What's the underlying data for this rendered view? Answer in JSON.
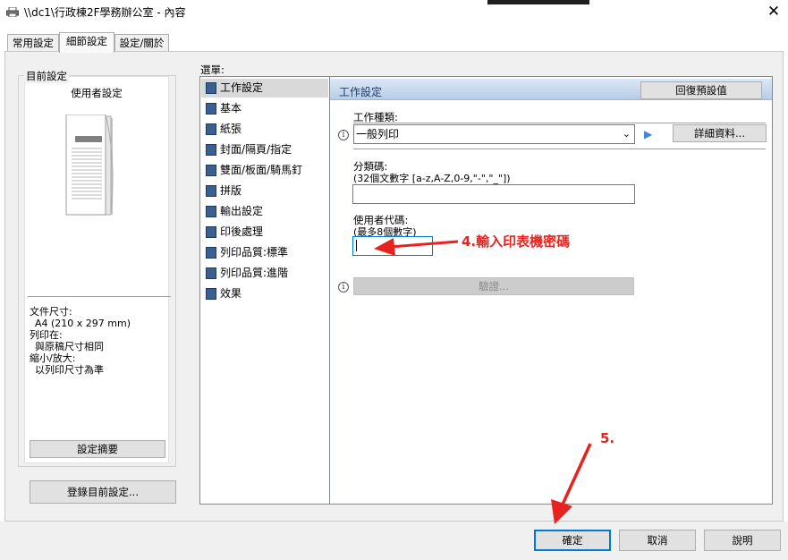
{
  "window": {
    "title": "\\\\dc1\\行政棟2F學務辦公室 - 內容",
    "close_glyph": "✕"
  },
  "tabs": [
    {
      "label": "常用設定"
    },
    {
      "label": "細節設定"
    },
    {
      "label": "設定/關於"
    }
  ],
  "current_settings": {
    "legend": "目前設定",
    "preview_title": "使用者設定",
    "info": {
      "paper_size_label": "文件尺寸:",
      "paper_size_value": "A4 (210 x 297 mm)",
      "print_on_label": "列印在:",
      "print_on_value": "與原稿尺寸相同",
      "zoom_label": "縮小/放大:",
      "zoom_value": "以列印尺寸為準"
    },
    "summary_button": "設定摘要",
    "register_button": "登錄目前設定..."
  },
  "menu": {
    "label": "選單:",
    "items": [
      {
        "label": "工作設定"
      },
      {
        "label": "基本"
      },
      {
        "label": "紙張"
      },
      {
        "label": "封面/隔頁/指定"
      },
      {
        "label": "雙面/板面/騎馬釘"
      },
      {
        "label": "拼版"
      },
      {
        "label": "輸出設定"
      },
      {
        "label": "印後處理"
      },
      {
        "label": "列印品質:標準"
      },
      {
        "label": "列印品質:進階"
      },
      {
        "label": "效果"
      }
    ]
  },
  "job_panel": {
    "title": "工作設定",
    "restore_button": "回復預設值",
    "job_type_label": "工作種類:",
    "job_type_value": "一般列印",
    "details_button": "詳細資料...",
    "classification_label": "分類碼:",
    "classification_hint": "(32個文數字 [a-z,A-Z,0-9,\"-\",\"_\"])",
    "classification_value": "",
    "user_code_label": "使用者代碼:",
    "user_code_hint": "(最多8個數字)",
    "user_code_value": "",
    "verify_button": "驗證..."
  },
  "annotations": {
    "step4": "4.輸入印表機密碼",
    "step5": "5.",
    "color": "#e8231f"
  },
  "footer": {
    "ok_button": "確定",
    "cancel_button": "取消",
    "help_button": "說明"
  },
  "icons": {
    "title_icon": "printer-icon",
    "info_icon": "info-icon",
    "play_icon": "play-icon",
    "dropdown_icon": "chevron-down-icon"
  }
}
